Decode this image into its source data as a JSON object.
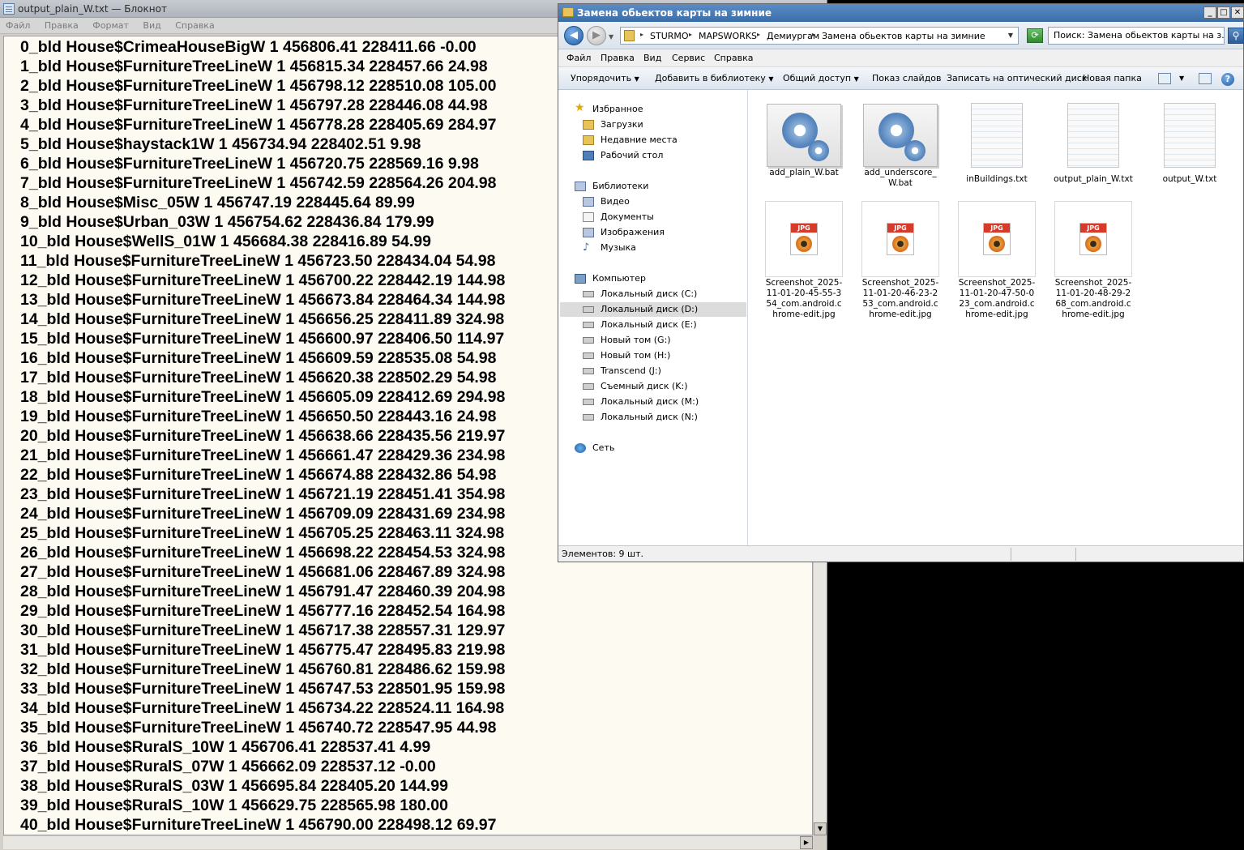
{
  "notepad": {
    "title": "output_plain_W.txt — Блокнот",
    "menu": [
      "Файл",
      "Правка",
      "Формат",
      "Вид",
      "Справка"
    ],
    "lines": [
      "0_bld House$CrimeaHouseBigW 1 456806.41 228411.66 -0.00",
      "1_bld House$FurnitureTreeLineW 1 456815.34 228457.66 24.98",
      "2_bld House$FurnitureTreeLineW 1 456798.12 228510.08 105.00",
      "3_bld House$FurnitureTreeLineW 1 456797.28 228446.08 44.98",
      "4_bld House$FurnitureTreeLineW 1 456778.28 228405.69 284.97",
      "5_bld House$haystack1W 1 456734.94 228402.51 9.98",
      "6_bld House$FurnitureTreeLineW 1 456720.75 228569.16 9.98",
      "7_bld House$FurnitureTreeLineW 1 456742.59 228564.26 204.98",
      "8_bld House$Misc_05W 1 456747.19 228445.64 89.99",
      "9_bld House$Urban_03W 1 456754.62 228436.84 179.99",
      "10_bld House$WellS_01W 1 456684.38 228416.89 54.99",
      "11_bld House$FurnitureTreeLineW 1 456723.50 228434.04 54.98",
      "12_bld House$FurnitureTreeLineW 1 456700.22 228442.19 144.98",
      "13_bld House$FurnitureTreeLineW 1 456673.84 228464.34 144.98",
      "14_bld House$FurnitureTreeLineW 1 456656.25 228411.89 324.98",
      "15_bld House$FurnitureTreeLineW 1 456600.97 228406.50 114.97",
      "16_bld House$FurnitureTreeLineW 1 456609.59 228535.08 54.98",
      "17_bld House$FurnitureTreeLineW 1 456620.38 228502.29 54.98",
      "18_bld House$FurnitureTreeLineW 1 456605.09 228412.69 294.98",
      "19_bld House$FurnitureTreeLineW 1 456650.50 228443.16 24.98",
      "20_bld House$FurnitureTreeLineW 1 456638.66 228435.56 219.97",
      "21_bld House$FurnitureTreeLineW 1 456661.47 228429.36 234.98",
      "22_bld House$FurnitureTreeLineW 1 456674.88 228432.86 54.98",
      "23_bld House$FurnitureTreeLineW 1 456721.19 228451.41 354.98",
      "24_bld House$FurnitureTreeLineW 1 456709.09 228431.69 234.98",
      "25_bld House$FurnitureTreeLineW 1 456705.25 228463.11 324.98",
      "26_bld House$FurnitureTreeLineW 1 456698.22 228454.53 324.98",
      "27_bld House$FurnitureTreeLineW 1 456681.06 228467.89 324.98",
      "28_bld House$FurnitureTreeLineW 1 456791.47 228460.39 204.98",
      "29_bld House$FurnitureTreeLineW 1 456777.16 228452.54 164.98",
      "30_bld House$FurnitureTreeLineW 1 456717.38 228557.31 129.97",
      "31_bld House$FurnitureTreeLineW 1 456775.47 228495.83 219.98",
      "32_bld House$FurnitureTreeLineW 1 456760.81 228486.62 159.98",
      "33_bld House$FurnitureTreeLineW 1 456747.53 228501.95 159.98",
      "34_bld House$FurnitureTreeLineW 1 456734.22 228524.11 164.98",
      "35_bld House$FurnitureTreeLineW 1 456740.72 228547.95 44.98",
      "36_bld House$RuralS_10W 1 456706.41 228537.41 4.99",
      "37_bld House$RuralS_07W 1 456662.09 228537.12 -0.00",
      "38_bld House$RuralS_03W 1 456695.84 228405.20 144.99",
      "39_bld House$RuralS_10W 1 456629.75 228565.98 180.00",
      "40_bld House$FurnitureTreeLineW 1 456790.00 228498.12 69.97"
    ]
  },
  "explorer": {
    "title": "Замена обьектов карты на зимние",
    "breadcrumbs": [
      "STURMO",
      "MAPSWORKS",
      "Демиургам",
      "Замена обьектов карты на зимние"
    ],
    "search_placeholder": "Поиск: Замена обьектов карты на з...",
    "menu": [
      "Файл",
      "Правка",
      "Вид",
      "Сервис",
      "Справка"
    ],
    "toolbar": {
      "organize": "Упорядочить",
      "add_library": "Добавить в библиотеку",
      "share": "Общий доступ",
      "slideshow": "Показ слайдов",
      "burn": "Записать на оптический диск",
      "new_folder": "Новая папка"
    },
    "nav": {
      "favorites": "Избранное",
      "downloads": "Загрузки",
      "recent": "Недавние места",
      "desktop": "Рабочий стол",
      "libraries": "Библиотеки",
      "video": "Видео",
      "documents": "Документы",
      "images": "Изображения",
      "music": "Музыка",
      "computer": "Компьютер",
      "drive_c": "Локальный диск (C:)",
      "drive_d": "Локальный диск (D:)",
      "drive_e": "Локальный диск (E:)",
      "drive_g": "Новый том (G:)",
      "drive_h": "Новый том (H:)",
      "drive_j": "Transcend (J:)",
      "drive_k": "Съемный диск (K:)",
      "drive_m": "Локальный диск (M:)",
      "drive_n": "Локальный диск (N:)",
      "network": "Сеть"
    },
    "files": {
      "f1": "add_plain_W.bat",
      "f2": "add_underscore_W.bat",
      "f3": "inBuildings.txt",
      "f4": "output_plain_W.txt",
      "f5": "output_W.txt",
      "f6": "Screenshot_2025-11-01-20-45-55-354_com.android.chrome-edit.jpg",
      "f7": "Screenshot_2025-11-01-20-46-23-253_com.android.chrome-edit.jpg",
      "f8": "Screenshot_2025-11-01-20-47-50-023_com.android.chrome-edit.jpg",
      "f9": "Screenshot_2025-11-01-20-48-29-268_com.android.chrome-edit.jpg"
    },
    "jpg_tag": "JPG",
    "status": "Элементов: 9 шт."
  }
}
